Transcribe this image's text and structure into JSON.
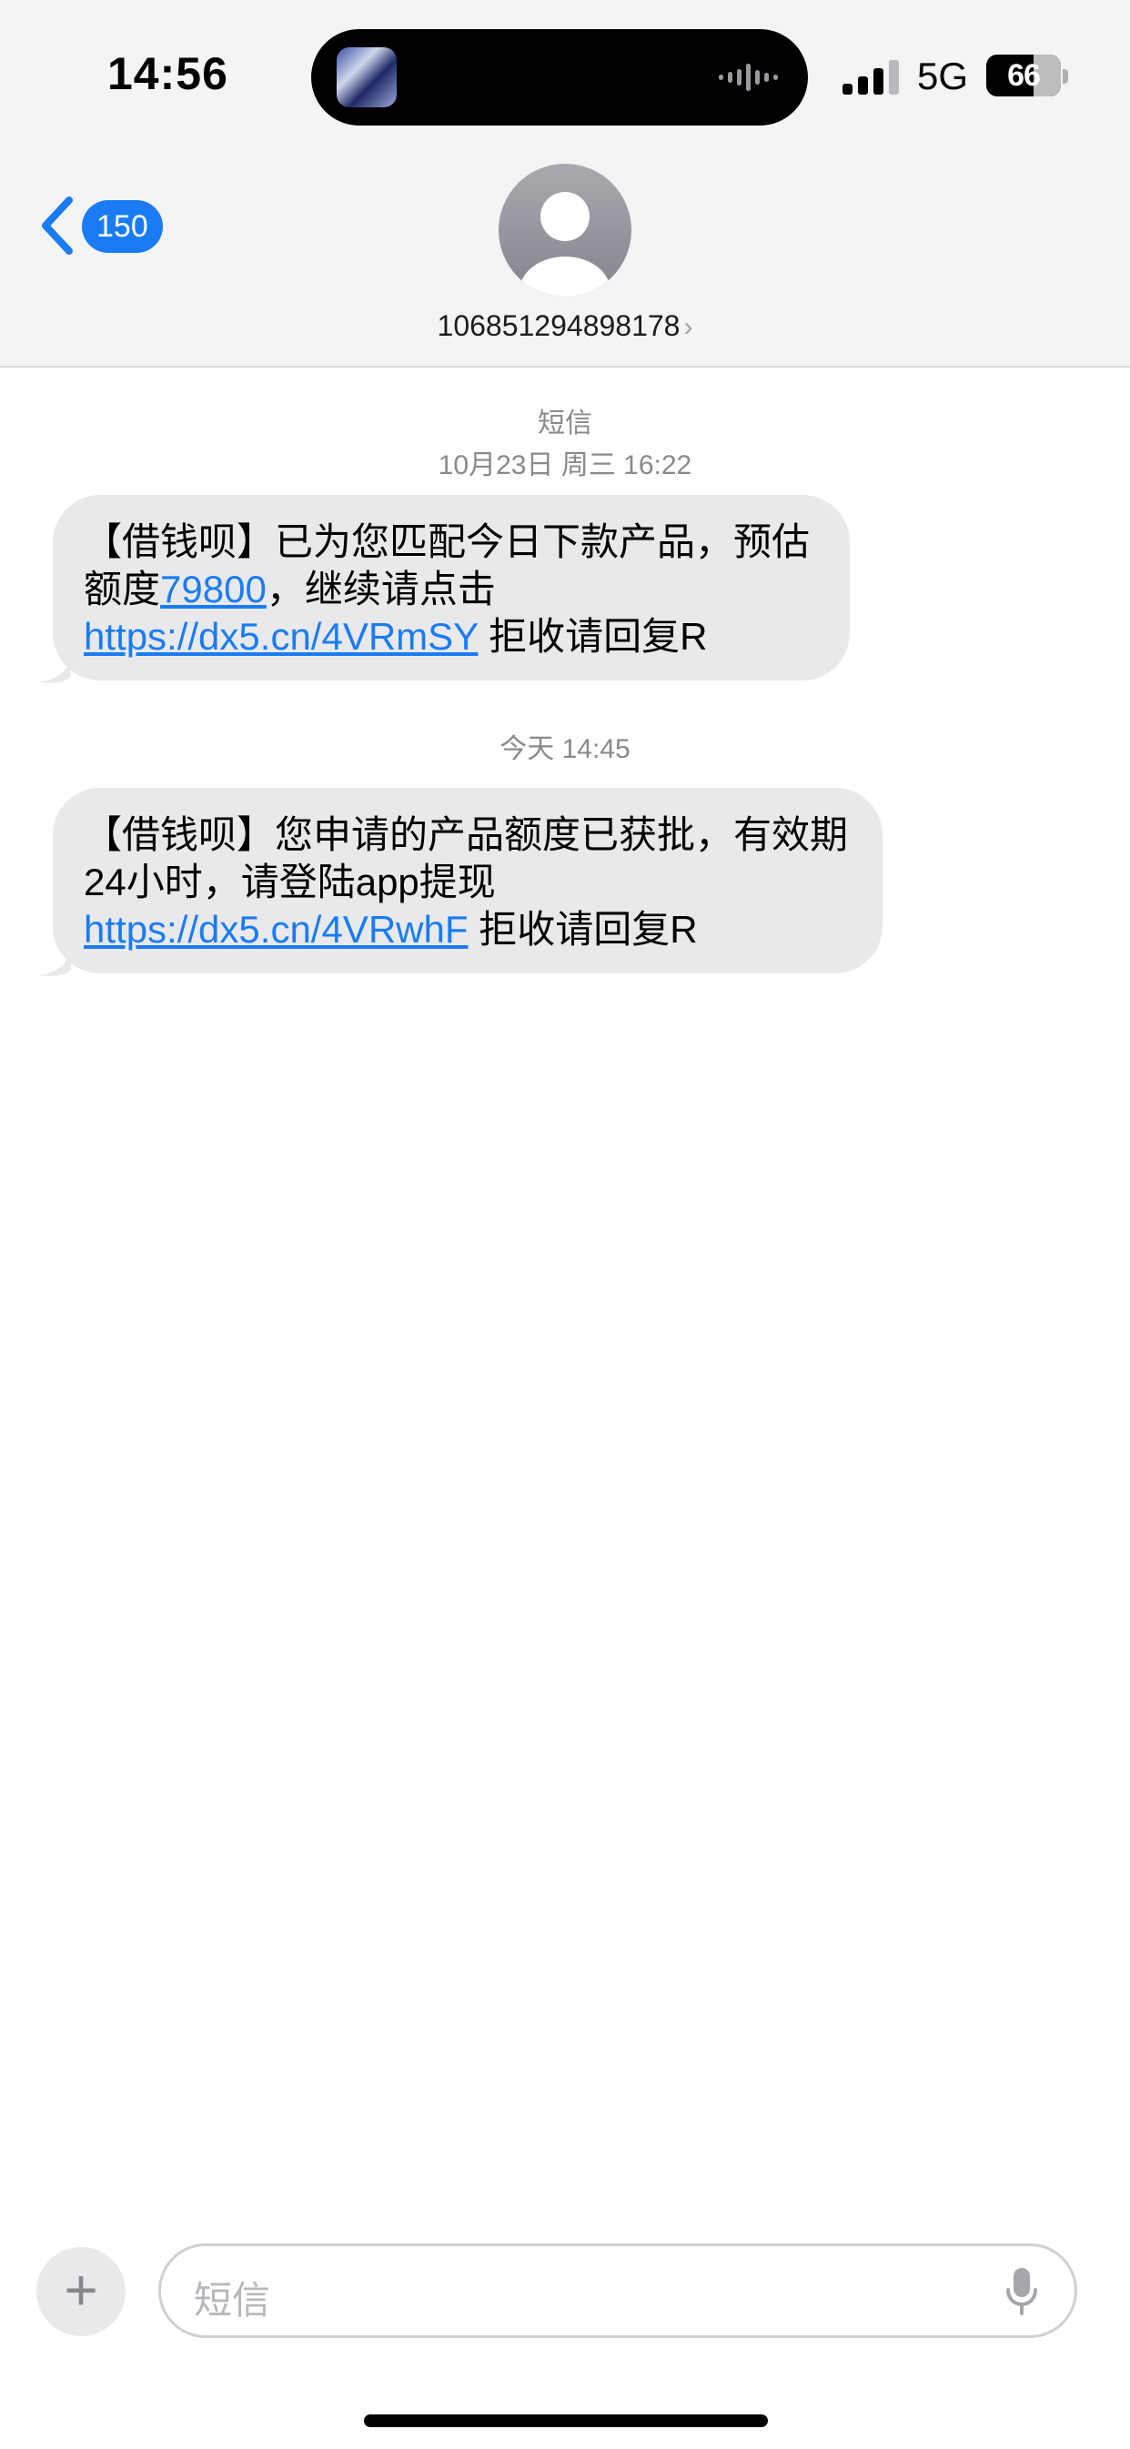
{
  "status_bar": {
    "time": "14:56",
    "network": "5G",
    "battery_level": "66"
  },
  "header": {
    "back_count": "150",
    "contact_number": "106851294898178",
    "contact_chevron": "›"
  },
  "thread": {
    "meta1": {
      "label": "短信",
      "date": "10月23日 周三",
      "time": "16:22"
    },
    "message1": {
      "part1": "【借钱呗】已为您匹配今日下款产品，预估额度",
      "link_amount": "79800",
      "part2": "，继续请点击 ",
      "link_url": "https://dx5.cn/4VRmSY",
      "part3": " 拒收请回复R"
    },
    "meta2": {
      "date": "今天",
      "time": "14:45"
    },
    "message2": {
      "part1": "【借钱呗】您申请的产品额度已获批，有效期24小时，请登陆app提现 ",
      "link_url": "https://dx5.cn/4VRwhF",
      "part2": " 拒收请回复R"
    }
  },
  "composer": {
    "placeholder": "短信",
    "plus_symbol": "+"
  },
  "colors": {
    "accent": "#1a7cf5",
    "bubble": "#e9e9eb",
    "meta_text": "#8a8a8e"
  },
  "icons": [
    "back-chevron-icon",
    "avatar-icon",
    "signal-icon",
    "plus-icon",
    "microphone-icon",
    "audio-wave-icon"
  ]
}
